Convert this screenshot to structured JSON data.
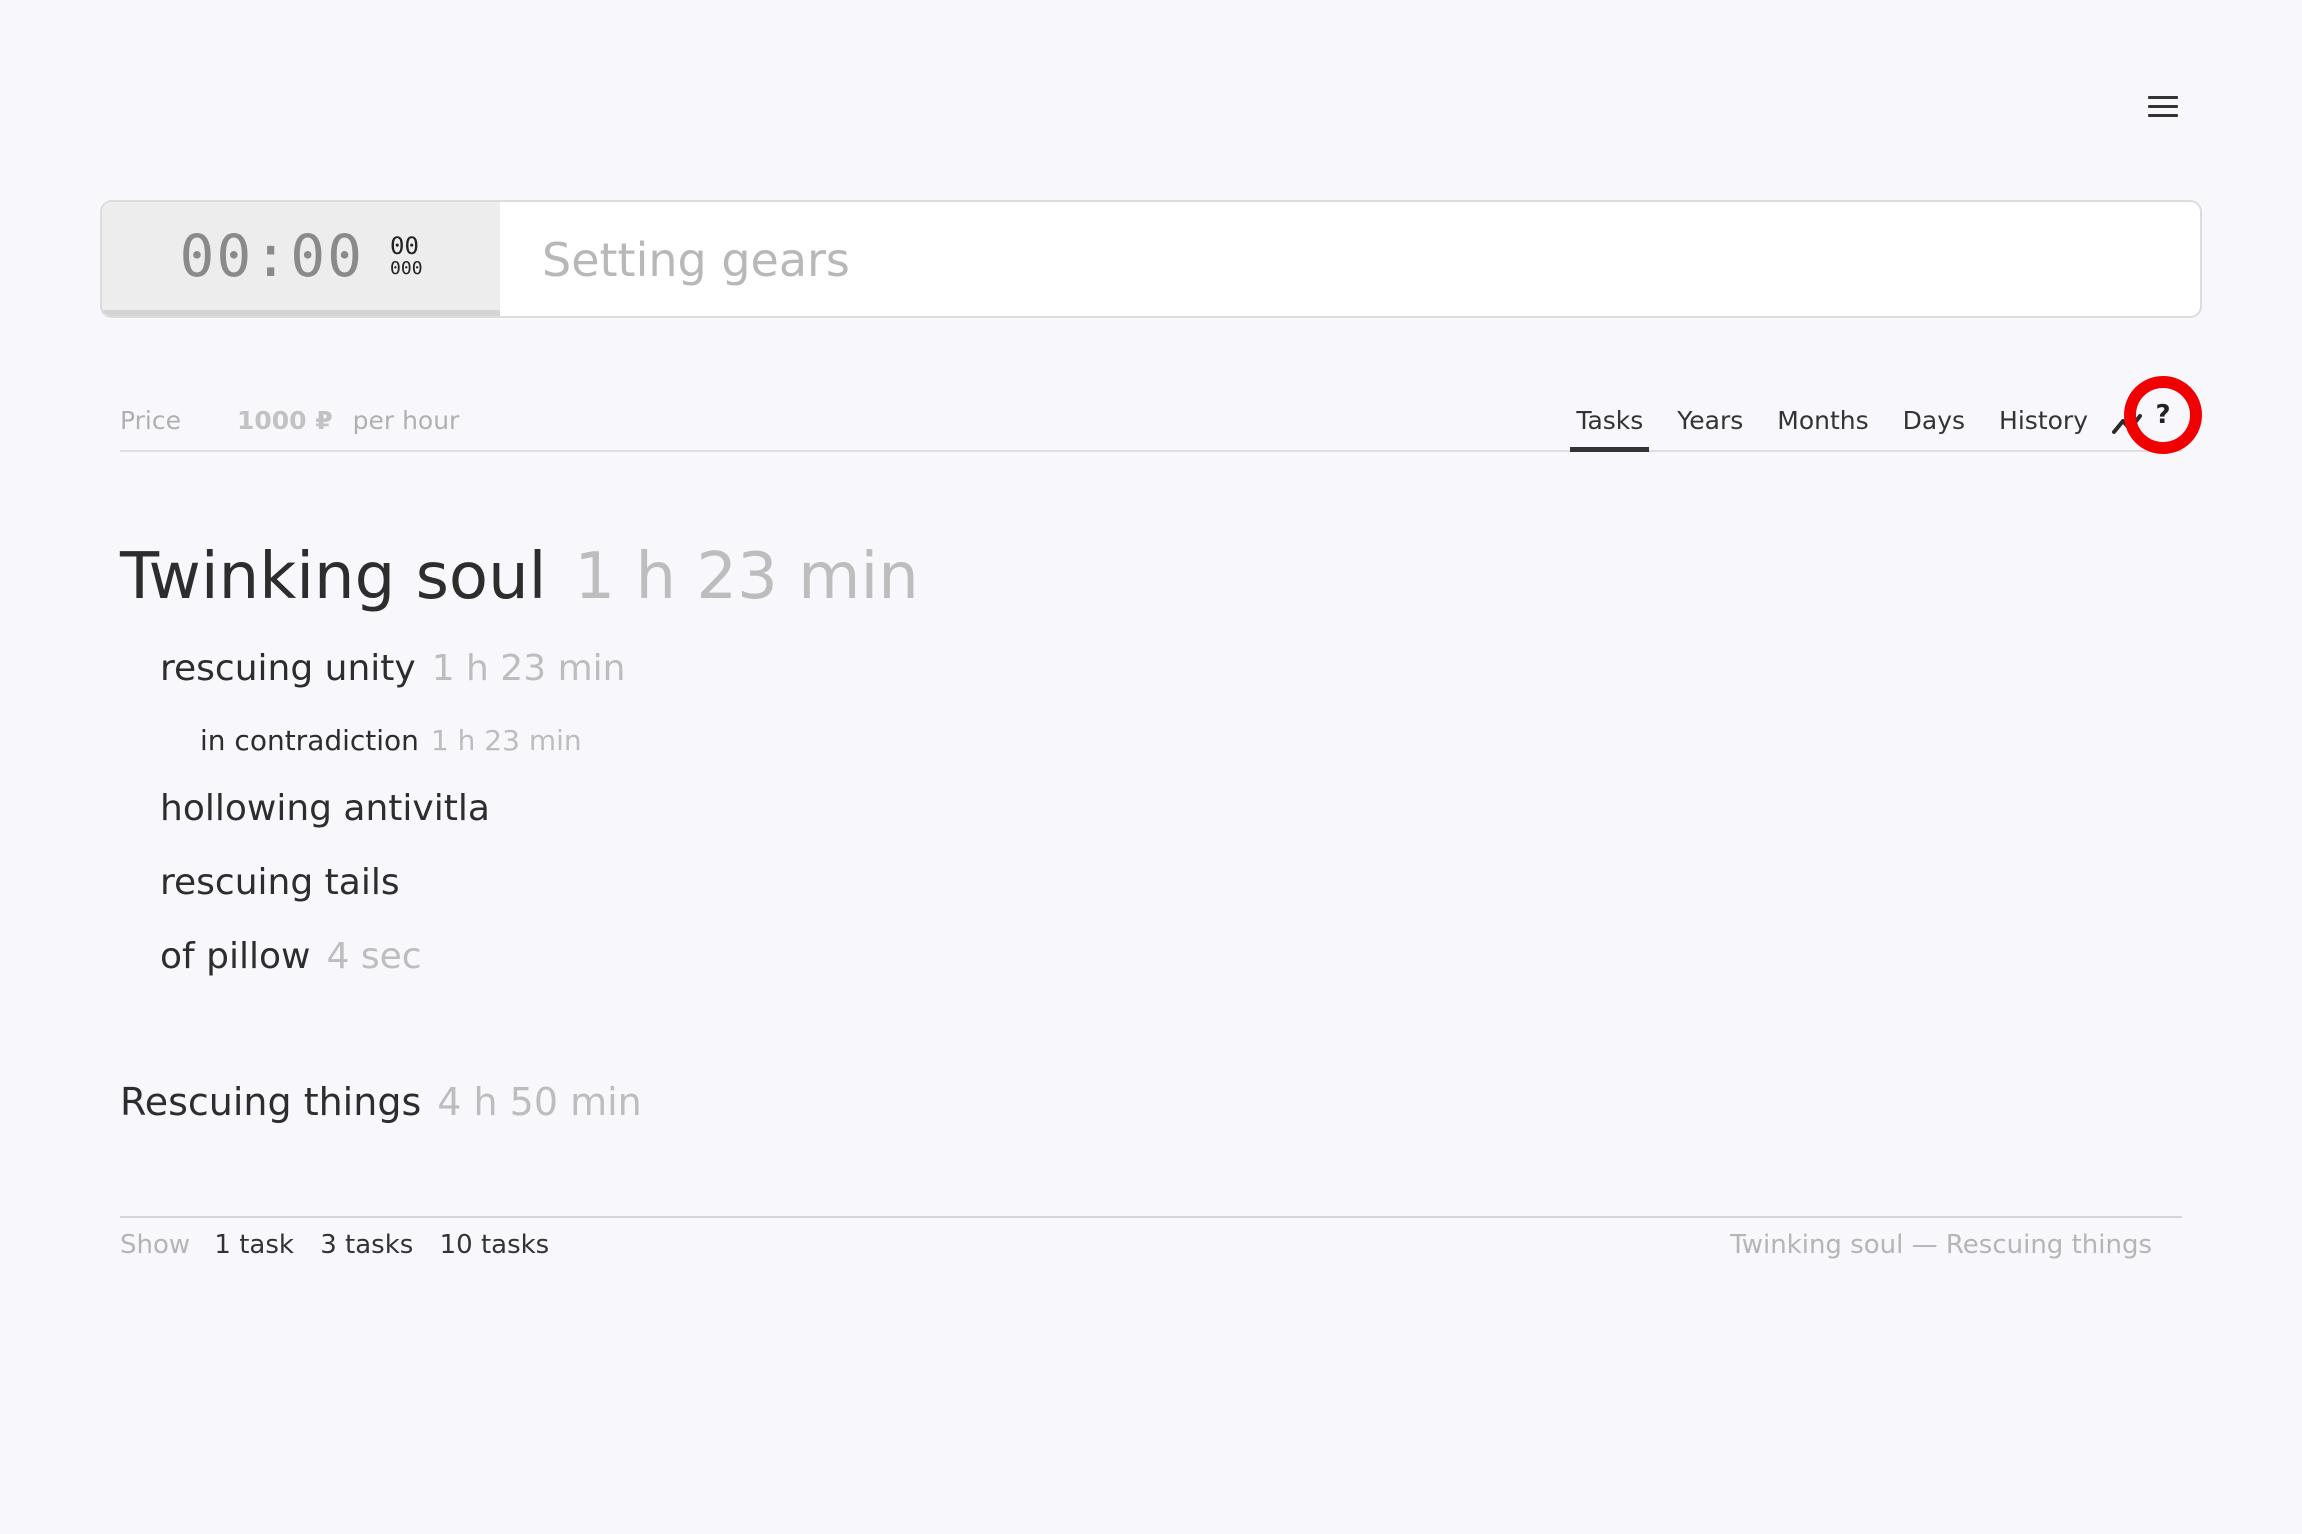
{
  "menu": {
    "icon": "hamburger-icon"
  },
  "timer": {
    "main": "00:00",
    "seconds": "00",
    "millis": "000",
    "placeholder": "Setting gears"
  },
  "price": {
    "label": "Price",
    "amount": "1000 ₽",
    "unit": "per hour"
  },
  "tabs": [
    "Tasks",
    "Years",
    "Months",
    "Days",
    "History"
  ],
  "active_tab": "Tasks",
  "icons": {
    "trend": "trend-chart-icon",
    "help": "?"
  },
  "help_highlight_color": "#f00000",
  "tree": {
    "project1": {
      "name": "Twinking soul",
      "time": "1 h 23 min"
    },
    "items": [
      {
        "name": "rescuing unity",
        "time": "1 h 23 min"
      },
      {
        "name": "in contradiction",
        "time": "1 h 23 min"
      },
      {
        "name": "hollowing antivitla",
        "time": ""
      },
      {
        "name": "rescuing tails",
        "time": ""
      },
      {
        "name": "of pillow",
        "time": "4 sec"
      }
    ],
    "project2": {
      "name": "Rescuing things",
      "time": "4 h 50 min"
    }
  },
  "footer": {
    "show_label": "Show",
    "options": [
      "1 task",
      "3 tasks",
      "10 tasks"
    ],
    "breadcrumb": "Twinking soul — Rescuing things"
  }
}
